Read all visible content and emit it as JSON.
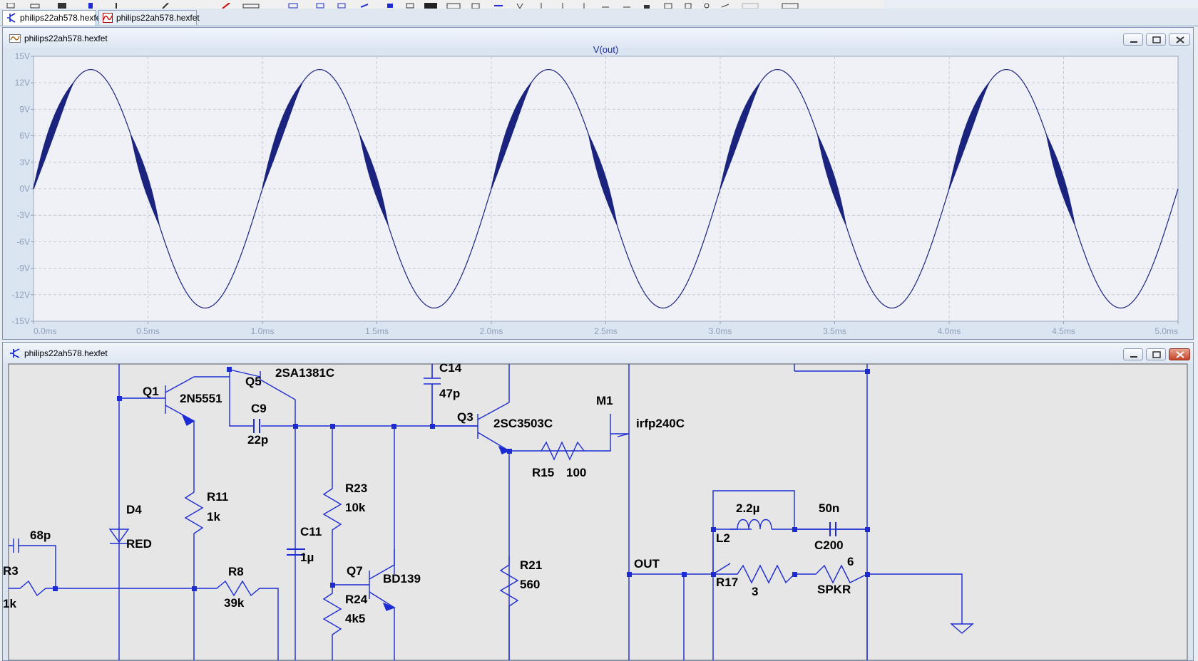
{
  "tabs": [
    {
      "label": "philips22ah578.hexfet",
      "icon": "schematic-icon",
      "active": true
    },
    {
      "label": "philips22ah578.hexfet",
      "icon": "waveform-icon",
      "active": false
    }
  ],
  "plot_window": {
    "title": "philips22ah578.hexfet",
    "icon": "waveform-icon"
  },
  "schematic_window": {
    "title": "philips22ah578.hexfet",
    "icon": "schematic-icon"
  },
  "window_buttons": {
    "minimize": "minimize-icon",
    "restore": "restore-icon",
    "close": "close-icon"
  },
  "colors": {
    "trace": "#1a237e",
    "wire": "#1c2bd3",
    "junction": "#1c2bd3",
    "plot_bg": "#f0f1f7",
    "schem_bg": "#e6e6e6",
    "grid": "#c3c8d6",
    "tick_text": "#8f9fb8",
    "close_button": "#c5432a"
  },
  "chart_data": {
    "type": "line",
    "title": "V(out)",
    "xlabel": "",
    "ylabel": "",
    "xlim": [
      0.0,
      5.0
    ],
    "ylim": [
      -15,
      15
    ],
    "x_unit": "ms",
    "y_unit": "V",
    "grid": true,
    "x_ticks": [
      "0.0ms",
      "0.5ms",
      "1.0ms",
      "1.5ms",
      "2.0ms",
      "2.5ms",
      "3.0ms",
      "3.5ms",
      "4.0ms",
      "4.5ms",
      "5.0ms"
    ],
    "y_ticks": [
      "15V",
      "12V",
      "9V",
      "6V",
      "3V",
      "0V",
      "-3V",
      "-6V",
      "-9V",
      "-12V",
      "-15V"
    ],
    "series": [
      {
        "name": "V(out)",
        "waveform": "sine",
        "amplitude": 13.5,
        "frequency_khz": 1.0,
        "x": [
          0.0,
          0.25,
          0.5,
          0.75,
          1.0,
          1.25,
          1.5,
          1.75,
          2.0,
          2.25,
          2.5,
          2.75,
          3.0,
          3.25,
          3.5,
          3.75,
          4.0,
          4.25,
          4.5,
          4.75,
          5.0
        ],
        "y": [
          0,
          13.5,
          0,
          -13.5,
          0,
          13.5,
          0,
          -13.5,
          0,
          13.5,
          0,
          -13.5,
          0,
          13.5,
          0,
          -13.5,
          0,
          13.5,
          0,
          -13.5,
          0
        ],
        "oscillation_bands": [
          {
            "from_v": 0.0,
            "to_v": 12.0,
            "phase": "rising"
          },
          {
            "from_v": 6.0,
            "to_v": -4.0,
            "phase": "falling"
          }
        ]
      }
    ]
  },
  "schematic": {
    "components": [
      {
        "ref": "Q1",
        "value": "2N5551"
      },
      {
        "ref": "Q5",
        "value": "2SA1381C"
      },
      {
        "ref": "C9",
        "value": "22p"
      },
      {
        "ref": "C14",
        "value": "47p"
      },
      {
        "ref": "Q3",
        "value": "2SC3503C"
      },
      {
        "ref": "M1",
        "value": "irfp240C"
      },
      {
        "ref": "R15",
        "value": "100"
      },
      {
        "ref": "R11",
        "value": "1k"
      },
      {
        "ref": "D4",
        "value": "RED"
      },
      {
        "ref": "R23",
        "value": "10k"
      },
      {
        "ref": "C11",
        "value": "1µ"
      },
      {
        "ref": "Q7",
        "value": "BD139"
      },
      {
        "ref": "R24",
        "value": "4k5"
      },
      {
        "ref": "R21",
        "value": "560"
      },
      {
        "ref": "R8",
        "value": "39k"
      },
      {
        "ref": "L2",
        "value": "2.2µ"
      },
      {
        "ref": "C200",
        "value": "50n"
      },
      {
        "ref": "R17",
        "value": "3"
      },
      {
        "ref": "SPKR",
        "value": "6"
      }
    ],
    "partial_labels": {
      "c_left_value": "68p",
      "r3_ref": "R3",
      "r3_value": "1k"
    },
    "net_labels": {
      "out": "OUT"
    }
  }
}
